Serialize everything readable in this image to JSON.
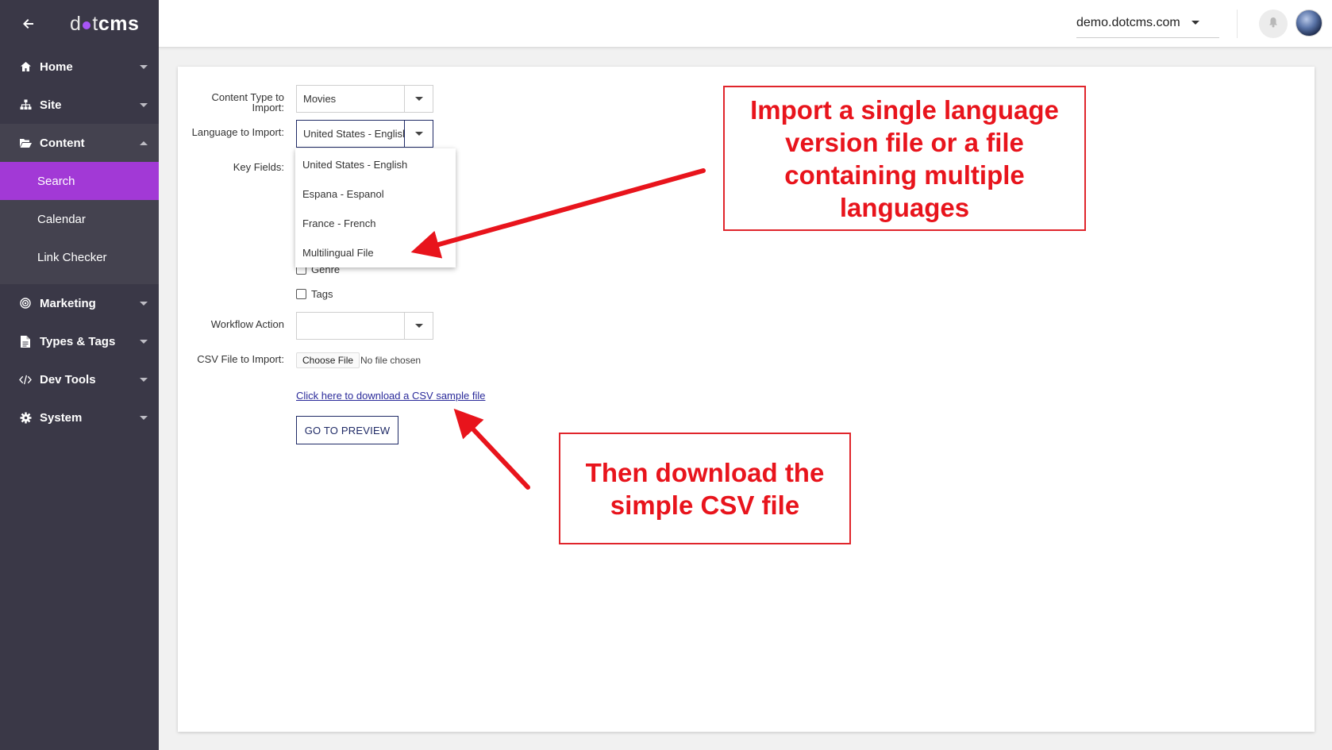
{
  "brand": {
    "logo_prefix": "d",
    "logo_mid": "t",
    "logo_suffix": "cms"
  },
  "sidebar": {
    "items": [
      {
        "label": "Home",
        "icon": "home-icon"
      },
      {
        "label": "Site",
        "icon": "sitemap-icon"
      },
      {
        "label": "Content",
        "icon": "folder-open-icon"
      },
      {
        "label": "Marketing",
        "icon": "target-icon"
      },
      {
        "label": "Types & Tags",
        "icon": "file-icon"
      },
      {
        "label": "Dev Tools",
        "icon": "code-icon"
      },
      {
        "label": "System",
        "icon": "gear-icon"
      }
    ],
    "content_sub": [
      {
        "label": "Search",
        "active": true
      },
      {
        "label": "Calendar",
        "active": false
      },
      {
        "label": "Link Checker",
        "active": false
      }
    ]
  },
  "topbar": {
    "site": "demo.dotcms.com"
  },
  "form": {
    "content_type_label": "Content Type to Import:",
    "content_type_value": "Movies",
    "language_label": "Language to Import:",
    "language_value": "United States - English",
    "key_fields_label": "Key Fields:",
    "language_options": [
      "United States - English",
      "Espana - Espanol",
      "France - French",
      "Multilingual File"
    ],
    "checkboxes": [
      "Genre",
      "Tags"
    ],
    "workflow_label": "Workflow Action",
    "workflow_value": "",
    "csv_label": "CSV File to Import:",
    "choose_file": "Choose File",
    "file_status": "No file chosen",
    "download_link": "Click here to download a CSV sample file",
    "preview_button": "GO TO PREVIEW"
  },
  "annotations": {
    "callout_1": "Import a single language version file or a file containing multiple languages",
    "callout_2": "Then download the simple CSV file",
    "color": "#e8141c"
  },
  "colors": {
    "sidebar_bg": "#3a3847",
    "active_item": "#a239d6",
    "accent_dark": "#1f2a66"
  }
}
